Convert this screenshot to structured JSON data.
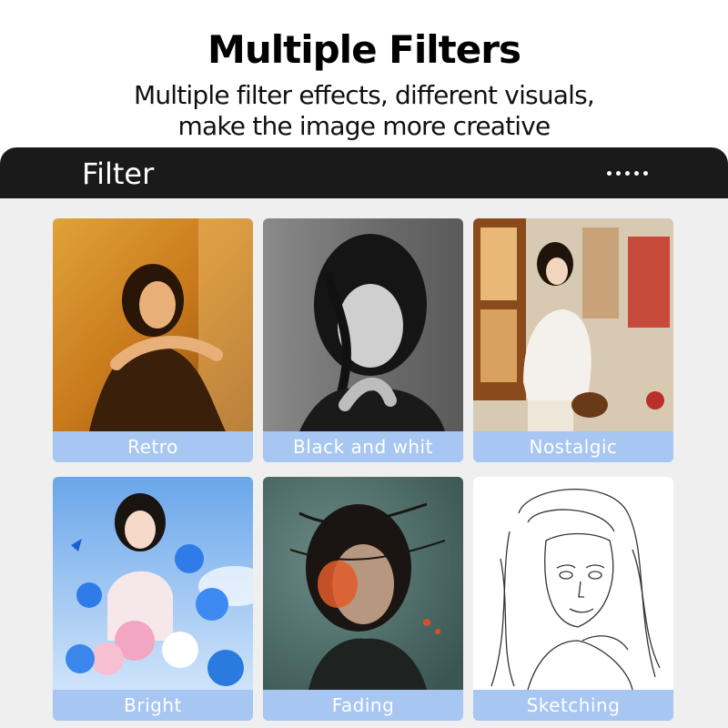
{
  "header": {
    "title": "Multiple Filters",
    "subtitle_line1": "Multiple filter effects, different visuals,",
    "subtitle_line2": "make the image more creative"
  },
  "panel": {
    "title": "Filter",
    "menu_icon": "more-dots-icon"
  },
  "filters": [
    {
      "label": "Retro"
    },
    {
      "label": "Black and whit"
    },
    {
      "label": "Nostalgic"
    },
    {
      "label": "Bright"
    },
    {
      "label": "Fading"
    },
    {
      "label": "Sketching"
    }
  ],
  "colors": {
    "label_bg": "#a7c6f1",
    "panel_bg": "#efefef",
    "bar_bg": "#1a1a1a"
  }
}
